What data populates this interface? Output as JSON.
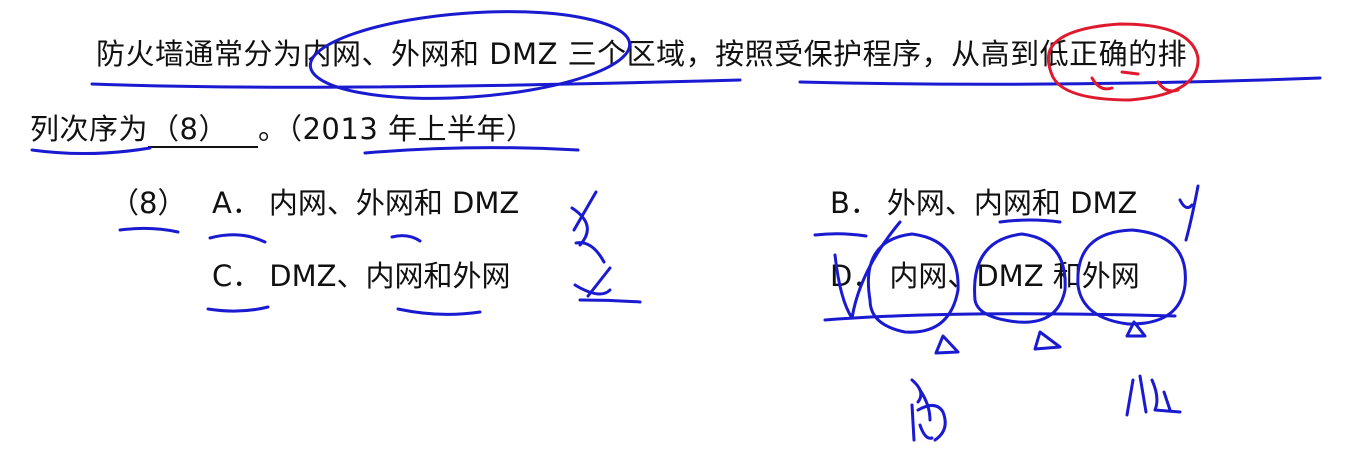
{
  "question": {
    "line1": "防火墙通常分为内网、外网和 DMZ 三个区域，按照受保护程序，从高到低正确的排",
    "line2_prefix": "列次序为",
    "blank_value": "（8）",
    "line2_suffix": "。（2013 年上半年）"
  },
  "options": {
    "number": "（8）",
    "a": {
      "letter": "A．",
      "text": "内网、外网和 DMZ"
    },
    "b": {
      "letter": "B．",
      "text": "外网、内网和 DMZ"
    },
    "c": {
      "letter": "C．",
      "text": "DMZ、内网和外网"
    },
    "d": {
      "letter": "D．",
      "text": "内网、DMZ 和外网"
    }
  },
  "annotations": {
    "blue_ink": "#1a1ad0",
    "red_ink": "#e0192e",
    "handwritten_high": "高",
    "handwritten_low": "低"
  }
}
